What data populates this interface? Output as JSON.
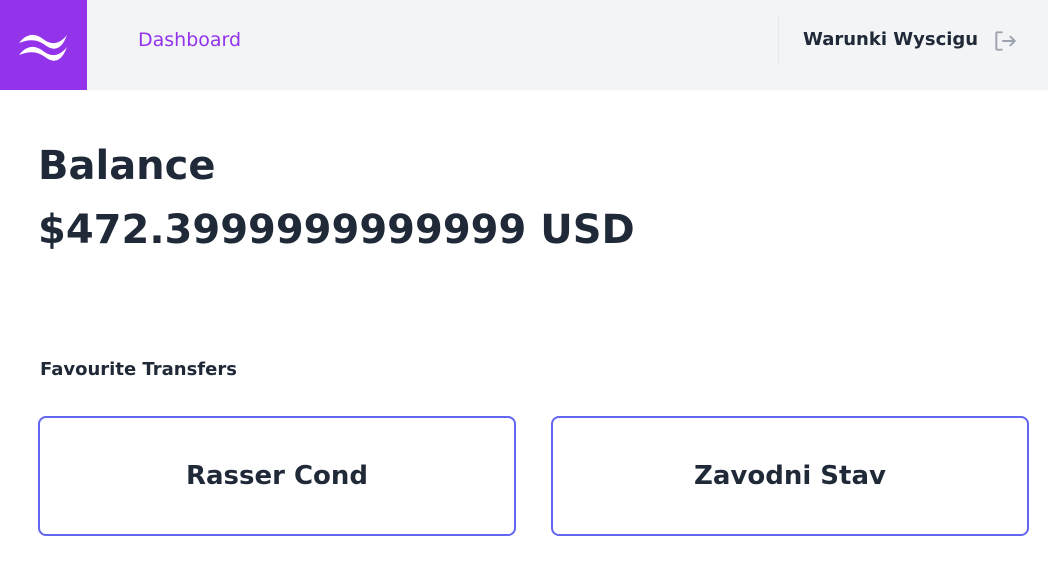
{
  "header": {
    "nav_link": "Dashboard",
    "user_name": "Warunki Wyscigu",
    "logo_icon": "tailwind-logo-icon",
    "logout_icon": "logout-icon"
  },
  "balance": {
    "heading": "Balance",
    "amount": "$472.3999999999999 USD"
  },
  "favourites": {
    "heading": "Favourite Transfers",
    "items": [
      {
        "name": "Rasser Cond"
      },
      {
        "name": "Zavodni Stav"
      }
    ]
  },
  "colors": {
    "brand": "#9333ea",
    "card_border": "#6366f1",
    "header_bg": "#f3f4f6",
    "text": "#1f2937"
  }
}
